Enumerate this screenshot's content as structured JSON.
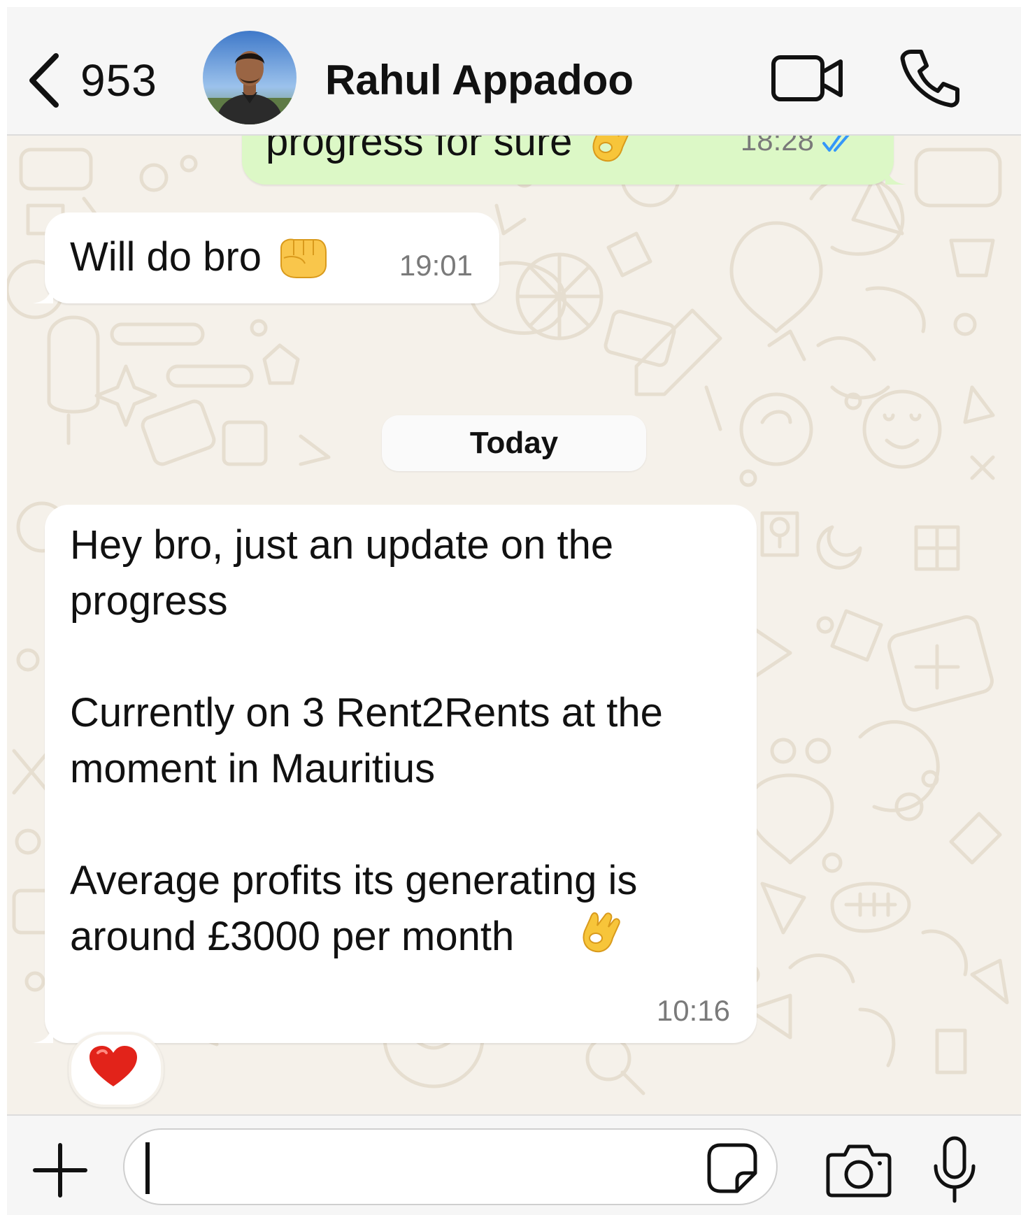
{
  "header": {
    "back_icon": "chevron-left-icon",
    "unread_count": "953",
    "contact_name": "Rahul Appadoo",
    "video_icon": "video-camera-icon",
    "call_icon": "phone-icon"
  },
  "messages": [
    {
      "direction": "outgoing",
      "text": "progress for sure",
      "emoji": "ok-hand",
      "time": "18:28",
      "status": "read",
      "status_color": "#3497f9"
    },
    {
      "direction": "incoming",
      "text": "Will do bro",
      "emoji": "fist-bump",
      "time": "19:01"
    },
    {
      "direction": "incoming",
      "paragraphs": [
        "Hey bro, just an update on the progress",
        "Currently on 3 Rent2Rents at the moment in Mauritius",
        "Average profits its generating is around £3000 per month"
      ],
      "emoji": "ok-hand",
      "time": "10:16",
      "reaction": "red-heart"
    }
  ],
  "date_separator": "Today",
  "composer": {
    "plus_icon": "plus-icon",
    "input_value": "",
    "sticker_icon": "sticker-icon",
    "camera_icon": "camera-icon",
    "mic_icon": "microphone-icon"
  },
  "colors": {
    "outgoing_bubble": "#dcf8c6",
    "incoming_bubble": "#ffffff",
    "wallpaper": "#f5f1ea",
    "read_ticks": "#3497f9"
  }
}
